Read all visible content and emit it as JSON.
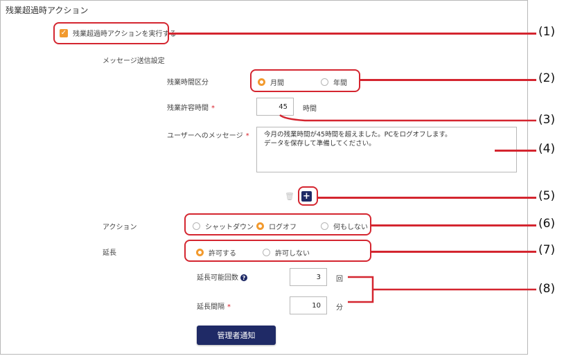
{
  "title": "残業超過時アクション",
  "enable": {
    "label": "残業超過時アクションを実行する",
    "checked": true
  },
  "message_settings": {
    "heading": "メッセージ送信設定"
  },
  "period": {
    "label": "残業時間区分",
    "options": [
      "月間",
      "年間"
    ],
    "selected": "月間"
  },
  "allowed_hours": {
    "label": "残業許容時間",
    "required_mark": "*",
    "value": "45",
    "unit": "時間"
  },
  "user_message": {
    "label": "ユーザーへのメッセージ",
    "required_mark": "*",
    "lines": [
      "今月の残業時間が45時間を超えました。PCをログオフします。",
      "データを保存して準備してください。"
    ]
  },
  "action": {
    "label": "アクション",
    "options": [
      "シャットダウン",
      "ログオフ",
      "何もしない"
    ],
    "selected": "ログオフ"
  },
  "extension": {
    "label": "延長",
    "options": [
      "許可する",
      "許可しない"
    ],
    "selected": "許可する"
  },
  "extension_count": {
    "label": "延長可能回数",
    "value": "3",
    "unit": "回"
  },
  "extension_interval": {
    "label": "延長間隔",
    "required_mark": "*",
    "value": "10",
    "unit": "分"
  },
  "admin_notify_button": "管理者通知",
  "callouts": [
    "(1)",
    "(2)",
    "(3)",
    "(4)",
    "(5)",
    "(6)",
    "(7)",
    "(8)"
  ],
  "colors": {
    "accent": "#f29a2e",
    "primary": "#1f2a66",
    "callout": "#d4252f"
  }
}
